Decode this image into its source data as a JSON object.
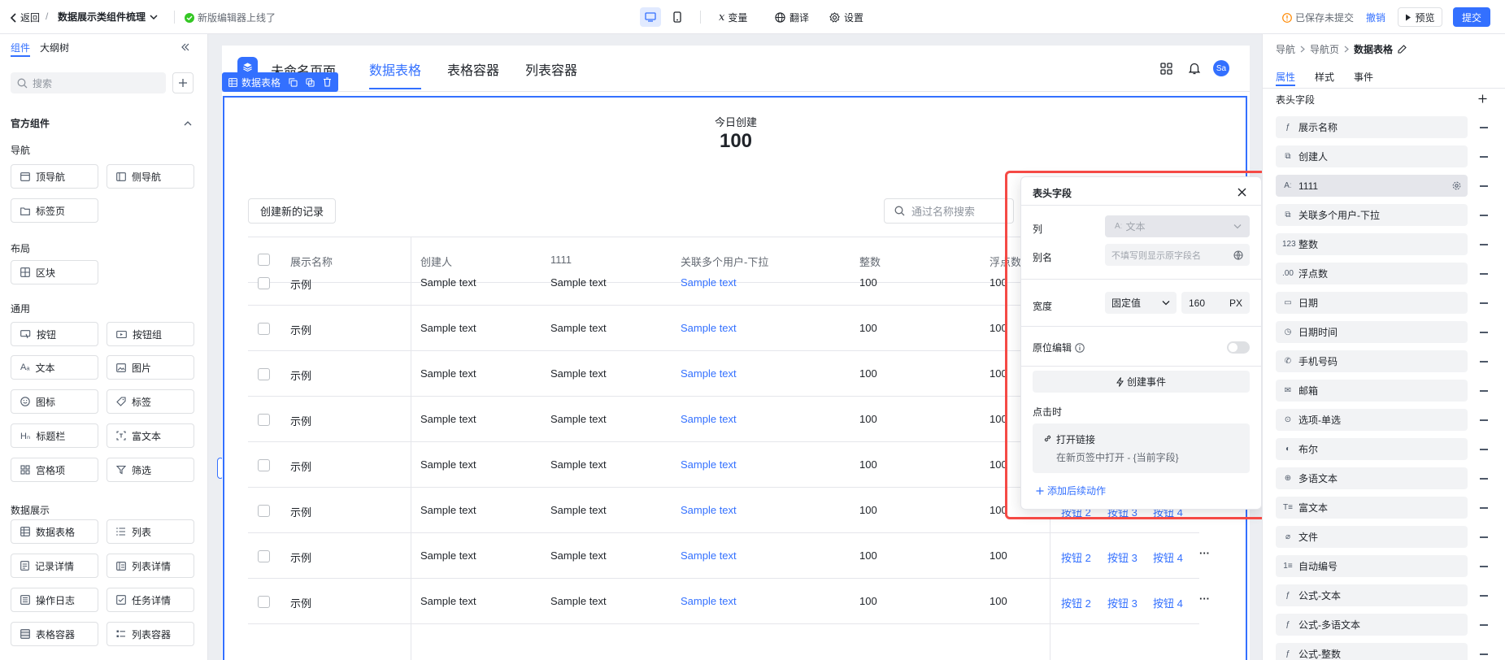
{
  "topbar": {
    "back_label": "返回",
    "separator": "/",
    "project_title": "数据展示类组件梳理",
    "notice": "新版编辑器上线了",
    "view_desktop": "desktop-icon",
    "view_mobile": "mobile-icon",
    "variables_label": "变量",
    "translate_label": "翻译",
    "settings_label": "设置",
    "save_status": "已保存未提交",
    "undo_label": "撤销",
    "preview_label": "预览",
    "submit_label": "提交",
    "accent": "#3370ff",
    "warning_color": "#ff8800"
  },
  "left_panel": {
    "tabs": [
      "组件",
      "大纲树"
    ],
    "search_placeholder": "搜索",
    "official_title": "官方组件",
    "groups": {
      "nav": "导航",
      "layout": "布局",
      "general": "通用",
      "data": "数据展示"
    },
    "items": {
      "top_nav": "顶导航",
      "side_nav": "侧导航",
      "tab_page": "标签页",
      "block": "区块",
      "button": "按钮",
      "button_group": "按钮组",
      "text": "文本",
      "image": "图片",
      "icon": "图标",
      "tag": "标签",
      "title_bar": "标题栏",
      "rich_text": "富文本",
      "grid_item": "宫格项",
      "filter": "筛选",
      "data_table": "数据表格",
      "list": "列表",
      "record_detail": "记录详情",
      "list_detail": "列表详情",
      "op_log": "操作日志",
      "task_detail": "任务详情",
      "table_container": "表格容器",
      "list_container": "列表容器"
    }
  },
  "canvas": {
    "page_name": "未命名页面",
    "tabs": [
      "数据表格",
      "表格容器",
      "列表容器"
    ],
    "avatar": "Sa",
    "selection_label": "数据表格",
    "stat_label": "今日创建",
    "stat_value": "100",
    "create_button": "创建新的记录",
    "search_placeholder": "通过名称搜索",
    "columns": [
      "展示名称",
      "创建人",
      "1111",
      "关联多个用户-下拉",
      "整数",
      "浮点数"
    ],
    "rows": [
      [
        "示例",
        "Sample text",
        "Sample text",
        "Sample text",
        "100",
        "100"
      ],
      [
        "示例",
        "Sample text",
        "Sample text",
        "Sample text",
        "100",
        "100"
      ],
      [
        "示例",
        "Sample text",
        "Sample text",
        "Sample text",
        "100",
        "100"
      ],
      [
        "示例",
        "Sample text",
        "Sample text",
        "Sample text",
        "100",
        "100"
      ],
      [
        "示例",
        "Sample text",
        "Sample text",
        "Sample text",
        "100",
        "100"
      ],
      [
        "示例",
        "Sample text",
        "Sample text",
        "Sample text",
        "100",
        "100"
      ],
      [
        "示例",
        "Sample text",
        "Sample text",
        "Sample text",
        "100",
        "100"
      ],
      [
        "示例",
        "Sample text",
        "Sample text",
        "Sample text",
        "100",
        "100"
      ]
    ],
    "row_actions": [
      "按钮 2",
      "按钮 3",
      "按钮 4"
    ],
    "more": "···"
  },
  "popover": {
    "title": "表头字段",
    "column_label": "列",
    "column_value": "文本",
    "alias_label": "别名",
    "alias_placeholder": "不填写则显示原字段名",
    "width_label": "宽度",
    "width_mode": "固定值",
    "width_value": "160",
    "width_unit": "PX",
    "inline_edit_label": "原位编辑",
    "create_event": "创建事件",
    "on_click_label": "点击时",
    "action_title": "打开链接",
    "action_desc": "在新页签中打开 - {当前字段}",
    "add_action": "添加后续动作"
  },
  "right_panel": {
    "breadcrumb": [
      "导航",
      "导航页",
      "数据表格"
    ],
    "tabs": [
      "属性",
      "样式",
      "事件"
    ],
    "section_title": "表头字段",
    "fields": [
      {
        "icon": "ƒ",
        "label": "展示名称"
      },
      {
        "icon": "⧉",
        "label": "创建人"
      },
      {
        "icon": "Aː",
        "label": "1111"
      },
      {
        "icon": "⧉",
        "label": "关联多个用户-下拉"
      },
      {
        "icon": "123",
        "label": "整数"
      },
      {
        "icon": ".00",
        "label": "浮点数"
      },
      {
        "icon": "▭",
        "label": "日期"
      },
      {
        "icon": "◷",
        "label": "日期时间"
      },
      {
        "icon": "✆",
        "label": "手机号码"
      },
      {
        "icon": "✉",
        "label": "邮箱"
      },
      {
        "icon": "⊙",
        "label": "选项-单选"
      },
      {
        "icon": "◐",
        "label": "布尔"
      },
      {
        "icon": "⊕",
        "label": "多语文本"
      },
      {
        "icon": "T≡",
        "label": "富文本"
      },
      {
        "icon": "⌀",
        "label": "文件"
      },
      {
        "icon": "1≡",
        "label": "自动编号"
      },
      {
        "icon": "ƒ",
        "label": "公式-文本"
      },
      {
        "icon": "ƒ",
        "label": "公式-多语文本"
      },
      {
        "icon": "ƒ",
        "label": "公式-整数"
      }
    ]
  }
}
